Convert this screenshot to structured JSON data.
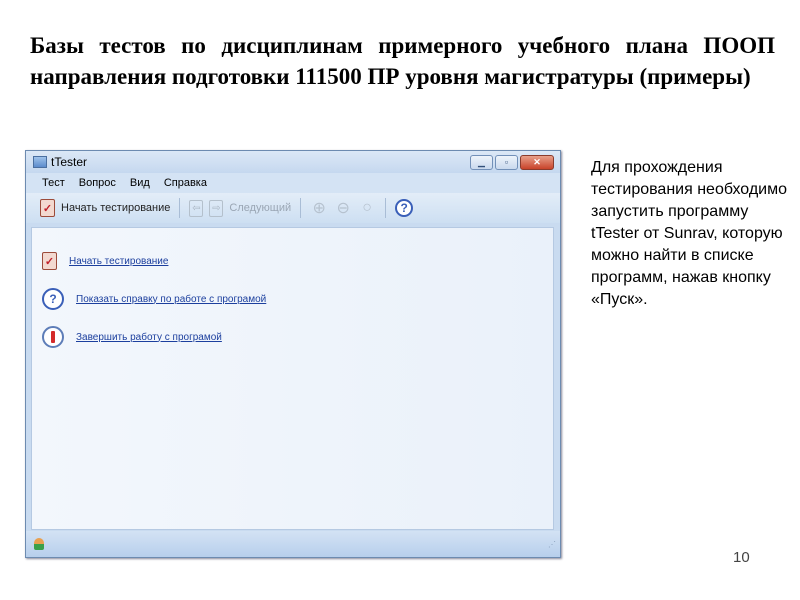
{
  "slide": {
    "title": "Базы тестов по дисциплинам примерного учебного плана ПООП направления подготовки 111500 ПР уровня магистратуры (примеры)",
    "description": "Для прохождения тестирования необходимо запустить программу tTester от Sunrav, которую можно найти в списке программ, нажав кнопку «Пуск».",
    "page_number": "10"
  },
  "window": {
    "title": "tTester",
    "menu": [
      "Тест",
      "Вопрос",
      "Вид",
      "Справка"
    ],
    "toolbar": {
      "start": "Начать тестирование",
      "next": "Следующий"
    },
    "links": [
      "Начать тестирование",
      "Показать справку по работе с програмой",
      "Завершить работу с програмой"
    ]
  }
}
